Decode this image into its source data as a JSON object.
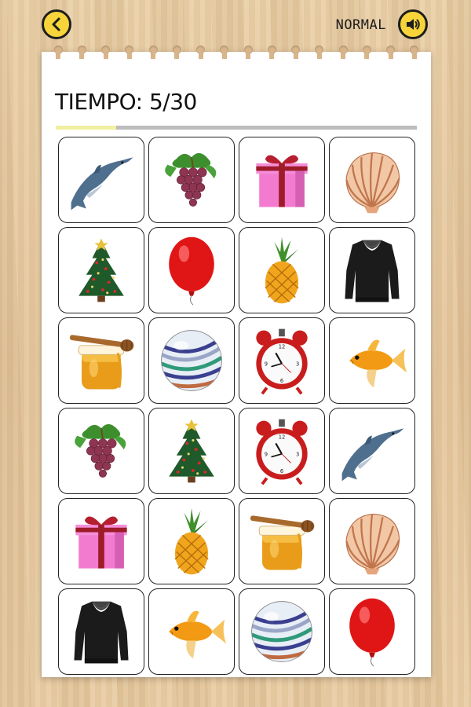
{
  "header": {
    "back_icon": "chevron-left-icon",
    "difficulty": "NORMAL",
    "sound_icon": "speaker-icon"
  },
  "game": {
    "timer_text": "TIEMPO: 5/30",
    "time_elapsed": 5,
    "time_total": 30,
    "progress_fraction": 0.1667
  },
  "cards": [
    "dolphin",
    "grapes",
    "gift",
    "shell",
    "christmas-tree",
    "balloon",
    "pineapple",
    "sweater",
    "honey",
    "marble",
    "alarm-clock",
    "goldfish",
    "grapes",
    "christmas-tree",
    "alarm-clock",
    "dolphin",
    "gift",
    "pineapple",
    "honey",
    "shell",
    "sweater",
    "goldfish",
    "marble",
    "balloon"
  ],
  "colors": {
    "button_yellow": "#f6d43a",
    "progress_fill": "#f0f0a0",
    "progress_track": "#bdbdbd"
  }
}
